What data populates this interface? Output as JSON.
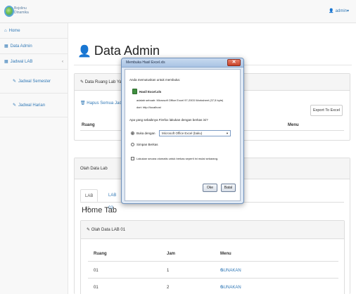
{
  "header": {
    "logo_text": "Bojolinu\nDinamika",
    "user_label": "admin",
    "user_icon": "user-icon",
    "caret": "▾"
  },
  "sidebar": {
    "items": [
      {
        "label": "Home",
        "icon": "home-icon"
      },
      {
        "label": "Data Admin",
        "icon": "table-icon"
      },
      {
        "label": "Jadwal LAB",
        "icon": "table-icon",
        "chevron": "‹"
      },
      {
        "label": "Jadwal Semester",
        "icon": "edit-icon"
      },
      {
        "label": "Jadwal Harian",
        "icon": "edit-icon"
      }
    ]
  },
  "main": {
    "title": "Data Admin",
    "panel1": {
      "heading": "Data Ruang Lab Yang",
      "hapus_link": "Hapus Semua Jadw",
      "export_button": "Export To Excel",
      "col_ruang": "Ruang",
      "col_menu": "Menu"
    },
    "panel2": {
      "heading": "Olah Data Lab",
      "tabs": [
        "LAB 01",
        "LAB 02"
      ],
      "tab_heading": "Home Tab",
      "inner_heading": "Olah Data LAB 01",
      "columns": [
        "Ruang",
        "Jam",
        "Menu"
      ],
      "rows": [
        {
          "ruang": "01",
          "jam": "1",
          "menu": "GUNAKAN"
        },
        {
          "ruang": "01",
          "jam": "2",
          "menu": "GUNAKAN"
        }
      ]
    }
  },
  "dialog": {
    "title": "Membuka Hasil Excel.xls",
    "close": "✕",
    "intro": "Anda memutuskan untuk membuka:",
    "file_name": "Hasil Excel.xls",
    "file_type": "adalah sebuah:  Microsoft Office Excel 97-2003 Worksheet (37,5 byte)",
    "file_source": "dari:  http://localhost",
    "question": "Apa yang sebaiknya Firefox lakukan dengan berkas ini?",
    "open_with_label": "Buka dengan",
    "open_with_value": "Microsoft Office Excel (baku)",
    "save_label": "Simpan Berkas",
    "auto_label": "Lakukan secara otomatis untuk berkas seperti ini mulai sekarang.",
    "ok_button": "Oke",
    "cancel_button": "Batal"
  }
}
